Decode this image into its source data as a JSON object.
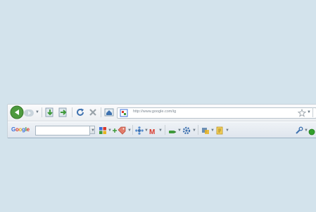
{
  "nav": {
    "url": "http://www.google.com/ig"
  },
  "google_toolbar": {
    "logo_letters": [
      "G",
      "o",
      "o",
      "g",
      "l",
      "e"
    ],
    "logo_colors": [
      "#3b6fd8",
      "#d9382b",
      "#e8b321",
      "#3b6fd8",
      "#3f9a3a",
      "#d9382b"
    ],
    "search_value": "",
    "gmail_label": "M"
  },
  "colors": {
    "back_green": "#4d9a3e",
    "reload_blue": "#3f72b0",
    "stop_gray": "#9aa3aa",
    "status_green": "#33a02c"
  }
}
